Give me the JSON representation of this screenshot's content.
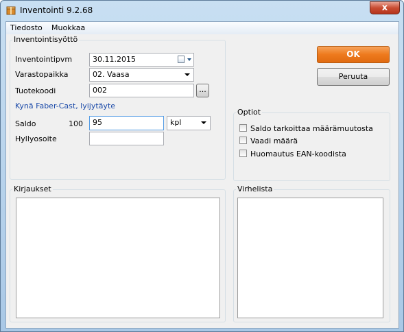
{
  "window": {
    "title": "Inventointi 9.2.68",
    "close_label": "x"
  },
  "menu": {
    "items": [
      "Tiedosto",
      "Muokkaa"
    ]
  },
  "entry": {
    "legend": "Inventointisyöttö",
    "date_label": "Inventointipvm",
    "date_value": "30.11.2015",
    "warehouse_label": "Varastopaikka",
    "warehouse_value": "02. Vaasa",
    "product_code_label": "Tuotekoodi",
    "product_code_value": "002",
    "browse_label": "...",
    "product_name": "Kynä Faber-Cast, lyijytäyte",
    "balance_label": "Saldo",
    "balance_current": "100",
    "balance_value": "95",
    "unit_value": "kpl",
    "shelf_label": "Hyllyosoite",
    "shelf_value": ""
  },
  "buttons": {
    "ok": "OK",
    "cancel": "Peruuta"
  },
  "options": {
    "legend": "Optiot",
    "items": [
      {
        "label": "Saldo tarkoittaa määrämuutosta",
        "checked": false
      },
      {
        "label": "Vaadi määrä",
        "checked": false
      },
      {
        "label": "Huomautus EAN-koodista",
        "checked": false
      }
    ]
  },
  "entries_panel": {
    "legend": "Kirjaukset"
  },
  "errors_panel": {
    "legend": "Virhelista"
  },
  "colors": {
    "ok_button": "#ee7a1d",
    "product_name": "#1a49a8",
    "close_button": "#c94d33"
  }
}
